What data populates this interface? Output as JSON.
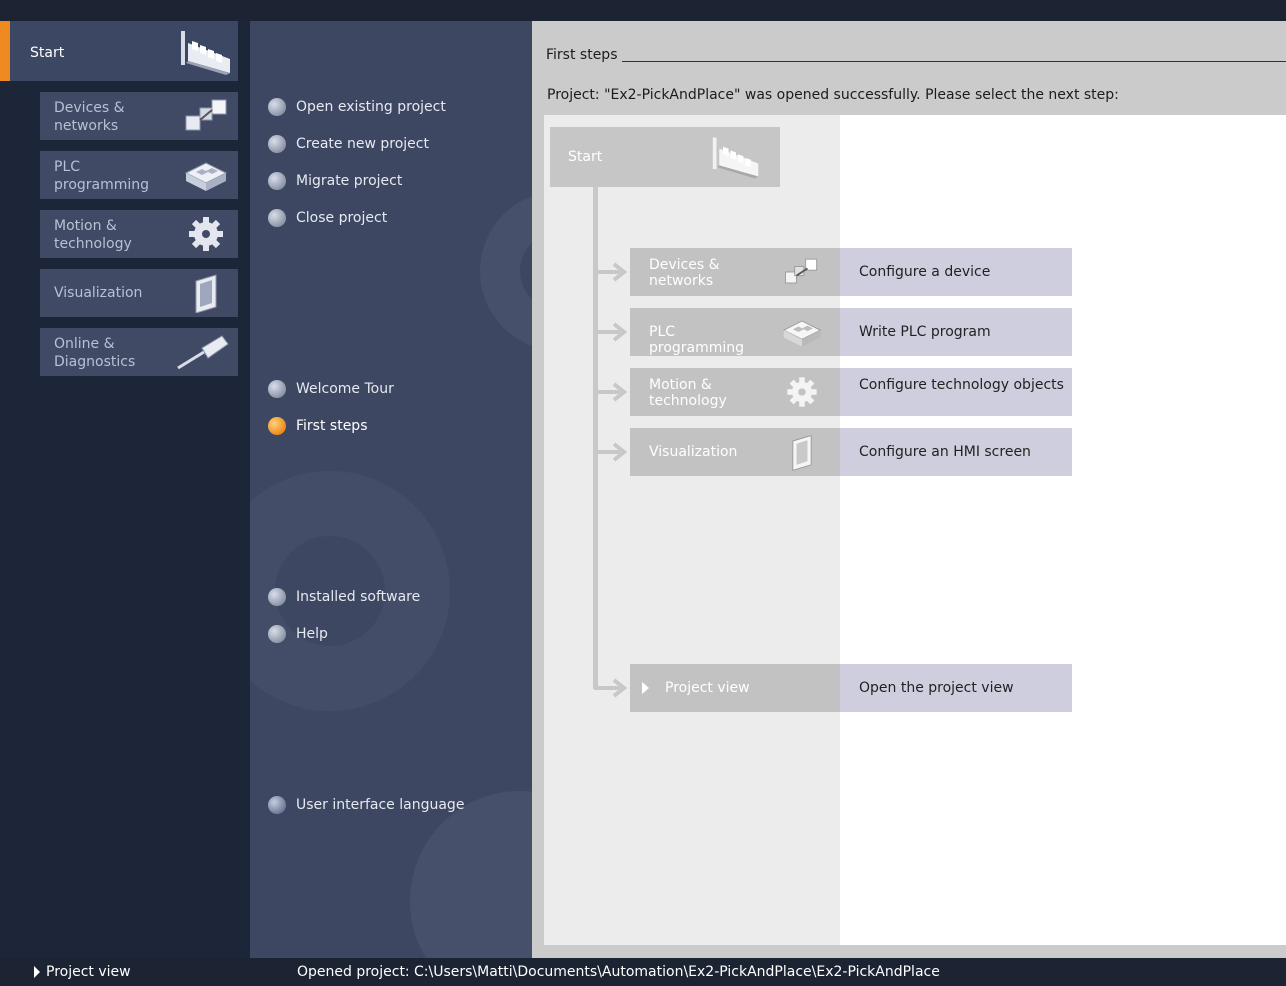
{
  "portal": {
    "start_label": "Start",
    "items": [
      {
        "label": "Devices & networks",
        "icon": "devices-networks-icon"
      },
      {
        "label": "PLC programming",
        "icon": "plc-programming-icon"
      },
      {
        "label": "Motion & technology",
        "icon": "gear-icon"
      },
      {
        "label": "Visualization",
        "icon": "hmi-panel-icon"
      },
      {
        "label": "Online & Diagnostics",
        "icon": "probe-icon"
      }
    ],
    "project_view": "Project view"
  },
  "actions": {
    "group1": [
      {
        "label": "Open existing project"
      },
      {
        "label": "Create new project"
      },
      {
        "label": "Migrate project"
      },
      {
        "label": "Close project"
      }
    ],
    "group2": [
      {
        "label": "Welcome Tour"
      },
      {
        "label": "First steps"
      }
    ],
    "group3": [
      {
        "label": "Installed software"
      },
      {
        "label": "Help"
      }
    ],
    "group4": [
      {
        "label": "User interface language"
      }
    ],
    "active": "First steps"
  },
  "content": {
    "title": "First steps",
    "message": "Project: \"Ex2-PickAndPlace\" was opened successfully. Please select the next step:",
    "flow_start": "Start",
    "steps": [
      {
        "left": "Devices & networks",
        "right": "Configure a device",
        "icon": "devices-networks-icon"
      },
      {
        "left": "PLC programming",
        "right": "Write PLC program",
        "icon": "plc-programming-icon"
      },
      {
        "left": "Motion & technology",
        "right": "Configure technology objects",
        "icon": "gear-icon"
      },
      {
        "left": "Visualization",
        "right": "Configure an HMI screen",
        "icon": "hmi-panel-icon"
      }
    ],
    "project_view_step": {
      "left": "Project view",
      "right": "Open the project view"
    }
  },
  "status": {
    "opened_label": "Opened project:",
    "opened_path": "C:\\Users\\Matti\\Documents\\Automation\\Ex2-PickAndPlace\\Ex2-PickAndPlace"
  },
  "colors": {
    "accent": "#ef8a22",
    "portal_bg": "#1d2538",
    "action_bg": "#3e4762",
    "step_right": "#cfcedf"
  }
}
